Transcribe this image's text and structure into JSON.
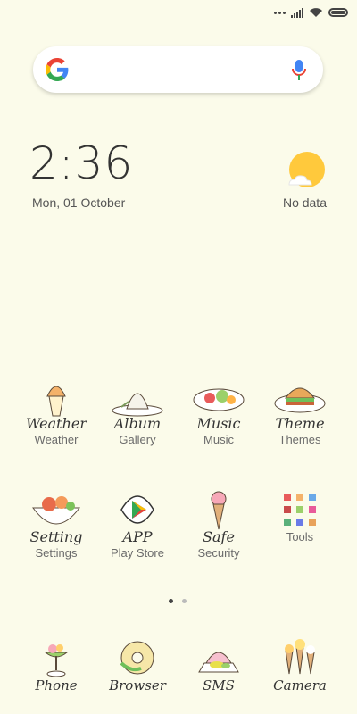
{
  "status_bar": {
    "icons": [
      "more-dots-icon",
      "signal-icon",
      "wifi-icon",
      "battery-icon"
    ]
  },
  "search": {
    "logo": "google-g-icon",
    "mic": "microphone-icon"
  },
  "clock_widget": {
    "time": "2:36",
    "date": "Mon, 01 October"
  },
  "weather_widget": {
    "icon": "weather-sun-cloud-icon",
    "label": "No data"
  },
  "home_apps": [
    {
      "script": "Weather",
      "label": "Weather",
      "icon": "ice-cream-cup-icon"
    },
    {
      "script": "Album",
      "label": "Gallery",
      "icon": "cake-plate-icon"
    },
    {
      "script": "Music",
      "label": "Music",
      "icon": "fruit-plate-icon"
    },
    {
      "script": "Theme",
      "label": "Themes",
      "icon": "burger-plate-icon"
    },
    {
      "script": "Setting",
      "label": "Settings",
      "icon": "salad-bowl-icon"
    },
    {
      "script": "APP",
      "label": "Play Store",
      "icon": "play-store-icon"
    },
    {
      "script": "Safe",
      "label": "Security",
      "icon": "ice-cream-cone-icon"
    },
    {
      "script": "",
      "label": "Tools",
      "icon": "tools-grid-icon"
    }
  ],
  "pager": {
    "active_index": 0,
    "count": 2
  },
  "dock_apps": [
    {
      "script": "Phone",
      "label": "",
      "icon": "sundae-glass-icon"
    },
    {
      "script": "Browser",
      "label": "",
      "icon": "donut-icon"
    },
    {
      "script": "SMS",
      "label": "",
      "icon": "cake-slice-icon"
    },
    {
      "script": "Camera",
      "label": "",
      "icon": "cones-icon"
    }
  ],
  "colors": {
    "background": "#fbfbea",
    "google_blue": "#4285F4",
    "google_red": "#EA4335",
    "google_yellow": "#FBBC05",
    "google_green": "#34A853",
    "sun": "#ffc93c"
  }
}
